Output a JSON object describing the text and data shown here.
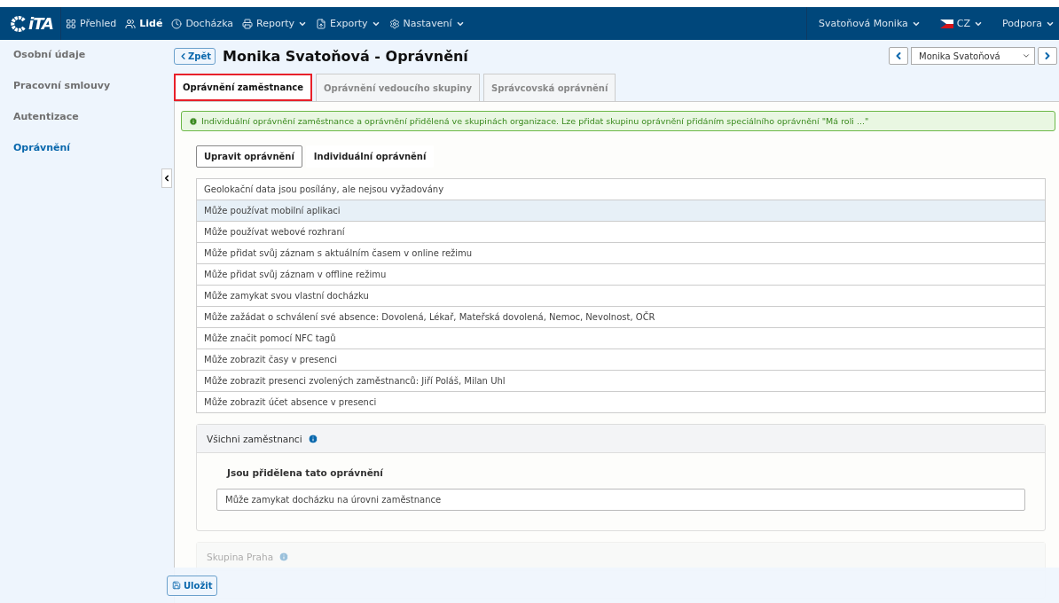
{
  "navbar": {
    "logo_text": "iTA",
    "menu": [
      {
        "label": "Přehled",
        "dropdown": false,
        "selected": false
      },
      {
        "label": "Lidé",
        "dropdown": false,
        "selected": true
      },
      {
        "label": "Docházka",
        "dropdown": false,
        "selected": false
      },
      {
        "label": "Reporty",
        "dropdown": true,
        "selected": false
      },
      {
        "label": "Exporty",
        "dropdown": true,
        "selected": false
      },
      {
        "label": "Nastavení",
        "dropdown": true,
        "selected": false
      }
    ],
    "user": "Svatoňová Monika",
    "language": "CZ",
    "support": "Podpora"
  },
  "sidebar": {
    "items": [
      {
        "label": "Osobní údaje",
        "selected": false
      },
      {
        "label": "Pracovní smlouvy",
        "selected": false
      },
      {
        "label": "Autentizace",
        "selected": false
      },
      {
        "label": "Oprávnění",
        "selected": true
      }
    ]
  },
  "header": {
    "back_button": "Zpět",
    "title": "Monika Svatoňová - Oprávnění",
    "employee_select": "Monika Svatoňová"
  },
  "tabs": [
    {
      "label": "Oprávnění zaměstnance",
      "selected": true
    },
    {
      "label": "Oprávnění vedoucího skupiny",
      "selected": false
    },
    {
      "label": "Správcovská oprávnění",
      "selected": false
    }
  ],
  "info_alert": "Individuální oprávnění zaměstnance a oprávnění přidělená ve skupinách organizace. Lze přidat skupinu oprávnění přidáním speciálního oprávnění \"Má roli ...\"",
  "subtabs": [
    {
      "label": "Upravit oprávnění",
      "selected": true
    },
    {
      "label": "Individuální oprávnění",
      "selected": false
    }
  ],
  "permissions": [
    {
      "label": "Geolokační data jsou posílány, ale nejsou vyžadovány",
      "selected": false
    },
    {
      "label": "Může používat mobilní aplikaci",
      "selected": true
    },
    {
      "label": "Může používat webové rozhraní",
      "selected": false
    },
    {
      "label": "Může přidat svůj záznam s aktuálním časem v online režimu",
      "selected": false
    },
    {
      "label": "Může přidat svůj záznam v offline režimu",
      "selected": false
    },
    {
      "label": "Může zamykat svou vlastní docházku",
      "selected": false
    },
    {
      "label": "Může zažádat o schválení své absence: Dovolená, Lékař, Mateřská dovolená, Nemoc, Nevolnost, OČR",
      "selected": false
    },
    {
      "label": "Může značit pomocí NFC tagů",
      "selected": false
    },
    {
      "label": "Může zobrazit časy v presenci",
      "selected": false
    },
    {
      "label": "Může zobrazit presenci zvolených zaměstnanců: Jiří Poláš, Milan Uhl",
      "selected": false
    },
    {
      "label": "Může zobrazit účet absence v presenci",
      "selected": false
    }
  ],
  "groups": [
    {
      "title": "Všichni zaměstnanci",
      "subtitle": "Jsou přidělena tato oprávnění",
      "items": [
        "Může zamykat docházku na úrovni zaměstnance"
      ]
    },
    {
      "title": "Skupina Praha"
    }
  ],
  "save_button": "Uložit"
}
